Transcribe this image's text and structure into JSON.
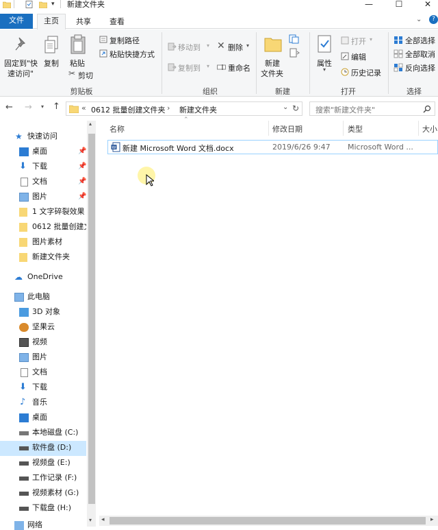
{
  "window": {
    "title": "新建文件夹",
    "minimize": "—",
    "maximize": "☐",
    "close": "✕"
  },
  "tabs": [
    {
      "label": "文件"
    },
    {
      "label": "主页"
    },
    {
      "label": "共享"
    },
    {
      "label": "查看"
    }
  ],
  "ribbon": {
    "clipboard": {
      "pin_label_1": "固定到\"快",
      "pin_label_2": "速访问\"",
      "copy": "复制",
      "paste": "粘贴",
      "copy_path": "复制路径",
      "paste_shortcut": "粘贴快捷方式",
      "cut": "剪切",
      "group": "剪贴板"
    },
    "organize": {
      "move_to": "移动到",
      "copy_to": "复制到",
      "delete": "删除",
      "rename": "重命名",
      "group": "组织"
    },
    "new": {
      "new_folder_1": "新建",
      "new_folder_2": "文件夹",
      "group": "新建"
    },
    "open": {
      "properties": "属性",
      "open": "打开",
      "edit": "编辑",
      "history": "历史记录",
      "group": "打开"
    },
    "select": {
      "select_all": "全部选择",
      "select_none": "全部取消",
      "invert": "反向选择",
      "group": "选择"
    }
  },
  "address": {
    "chevrons": "«",
    "crumb1": "0612 批量创建文件夹",
    "sep": "›",
    "crumb2": "新建文件夹",
    "search_placeholder": "搜索\"新建文件夹\""
  },
  "nav": {
    "quick_access": "快速访问",
    "quick_items": [
      {
        "label": "桌面",
        "pinned": true
      },
      {
        "label": "下载",
        "pinned": true
      },
      {
        "label": "文档",
        "pinned": true
      },
      {
        "label": "图片",
        "pinned": true
      },
      {
        "label": "1 文字碎裂效果",
        "pinned": false
      },
      {
        "label": "0612 批量创建文",
        "pinned": false
      },
      {
        "label": "图片素材",
        "pinned": false
      },
      {
        "label": "新建文件夹",
        "pinned": false
      }
    ],
    "onedrive": "OneDrive",
    "this_pc": "此电脑",
    "pc_items": [
      {
        "label": "3D 对象"
      },
      {
        "label": "坚果云"
      },
      {
        "label": "视频"
      },
      {
        "label": "图片"
      },
      {
        "label": "文档"
      },
      {
        "label": "下载"
      },
      {
        "label": "音乐"
      },
      {
        "label": "桌面"
      },
      {
        "label": "本地磁盘 (C:)"
      },
      {
        "label": "软件盘 (D:)"
      },
      {
        "label": "视频盘 (E:)"
      },
      {
        "label": "工作记录 (F:)"
      },
      {
        "label": "视频素材 (G:)"
      },
      {
        "label": "下载盘 (H:)"
      }
    ],
    "network": "网络"
  },
  "columns": {
    "name": "名称",
    "modified": "修改日期",
    "type": "类型",
    "size": "大小"
  },
  "files": [
    {
      "name": "新建 Microsoft Word 文档.docx",
      "modified": "2019/6/26 9:47",
      "type": "Microsoft Word ..."
    }
  ],
  "colors": {
    "accent": "#1a6fc0",
    "selected_row": "#cce8ff",
    "folder": "#f8d775"
  }
}
